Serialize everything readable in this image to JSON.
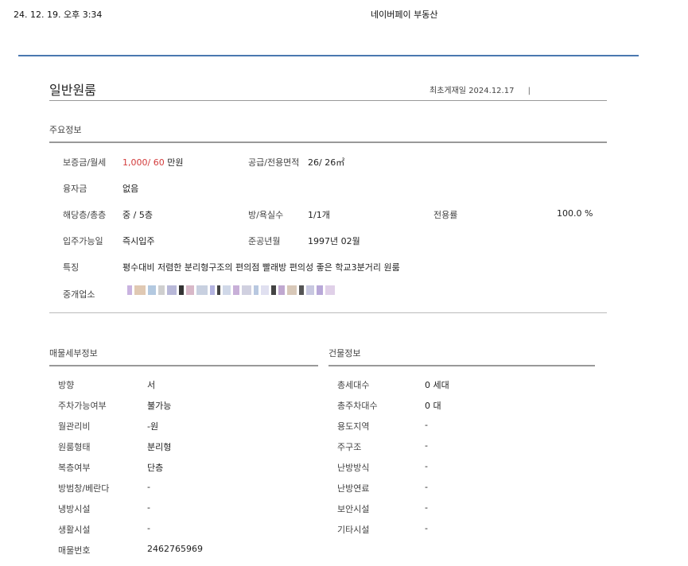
{
  "print_header": {
    "datetime": "24. 12. 19. 오후 3:34",
    "site": "네이버페이 부동산"
  },
  "listing": {
    "title": "일반원룸",
    "posted_label": "최초게재일",
    "posted_date": "2024.12.17",
    "posted_sep": "|"
  },
  "main_info": {
    "section_title": "주요정보",
    "deposit_label": "보증금/월세",
    "deposit_value": "1,000/ 60",
    "deposit_unit": "만원",
    "area_label": "공급/전용면적",
    "area_value": "26/ 26㎡",
    "loan_label": "융자금",
    "loan_value": "없음",
    "floor_label": "해당층/총층",
    "floor_value": "중 / 5층",
    "rooms_label": "방/욕실수",
    "rooms_value": "1/1개",
    "exclusive_label": "전용률",
    "exclusive_value": "100.0 %",
    "movein_label": "입주가능일",
    "movein_value": "즉시입주",
    "built_label": "준공년월",
    "built_value": "1997년 02월",
    "feature_label": "특징",
    "feature_value": "평수대비 저렴한 분리형구조의 편의점 빨래방 편의성 좋은 학교3분거리 원룸",
    "broker_label": "중개업소"
  },
  "detail_info": {
    "section_title": "매물세부정보",
    "rows": [
      {
        "k": "방향",
        "v": "서"
      },
      {
        "k": "주차가능여부",
        "v": "불가능"
      },
      {
        "k": "월관리비",
        "v": "-원"
      },
      {
        "k": "원룸형태",
        "v": "분리형"
      },
      {
        "k": "복층여부",
        "v": "단층"
      },
      {
        "k": "방범창/베란다",
        "v": "-"
      },
      {
        "k": "냉방시설",
        "v": "-"
      },
      {
        "k": "생활시설",
        "v": "-"
      },
      {
        "k": "매물번호",
        "v": "2462765969"
      }
    ]
  },
  "building_info": {
    "section_title": "건물정보",
    "rows": [
      {
        "k": "총세대수",
        "v": "0 세대"
      },
      {
        "k": "총주차대수",
        "v": "0 대"
      },
      {
        "k": "용도지역",
        "v": "-"
      },
      {
        "k": "주구조",
        "v": "-"
      },
      {
        "k": "난방방식",
        "v": "-"
      },
      {
        "k": "난방연료",
        "v": "-"
      },
      {
        "k": "보안시설",
        "v": "-"
      },
      {
        "k": "기타시설",
        "v": "-"
      }
    ]
  }
}
